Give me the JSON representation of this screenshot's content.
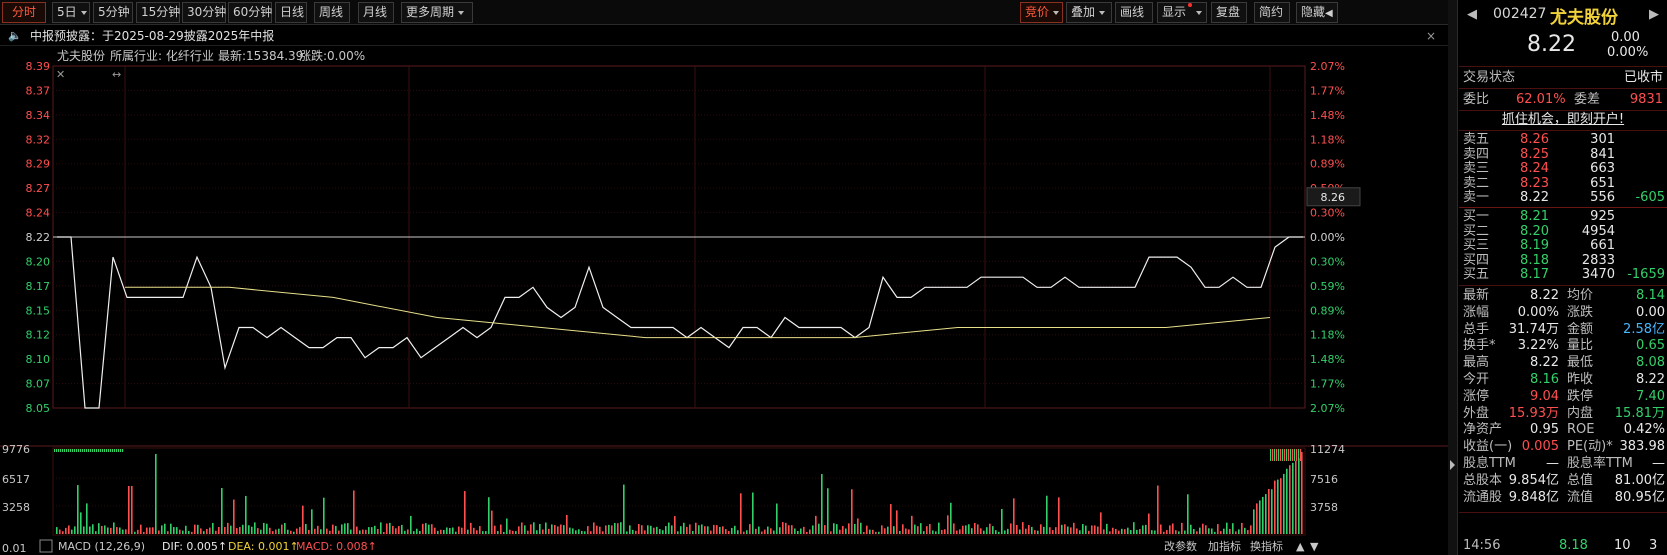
{
  "toolbar": {
    "left_buttons": [
      "分时",
      "5日",
      "5分钟",
      "15分钟",
      "30分钟",
      "60分钟",
      "日线",
      "周线",
      "月线",
      "更多周期"
    ],
    "right_buttons": [
      "竞价",
      "叠加",
      "画线",
      "显示",
      "复盘",
      "简约",
      "隐藏"
    ]
  },
  "notice": {
    "icon": "speaker-icon",
    "text": "中报预披露：于2025-08-29披露2025年中报",
    "close": "×"
  },
  "chart_header": {
    "stock": "尤夫股份",
    "industry_label": "所属行业: 化纤行业",
    "latest_label": "最新:15384.39",
    "change_label": "涨跌:0.00%"
  },
  "chart_data": {
    "type": "line",
    "price_axis": [
      "8.39",
      "8.37",
      "8.34",
      "8.32",
      "8.29",
      "8.27",
      "8.24",
      "8.22",
      "8.20",
      "8.17",
      "8.15",
      "8.12",
      "8.10",
      "8.07",
      "8.05"
    ],
    "pct_axis": [
      "2.07%",
      "1.77%",
      "1.48%",
      "1.18%",
      "0.89%",
      "0.59%",
      "0.30%",
      "0.00%",
      "0.30%",
      "0.59%",
      "0.89%",
      "1.18%",
      "1.48%",
      "1.77%",
      "2.07%"
    ],
    "ylim": [
      8.05,
      8.39
    ],
    "prev_close": 8.22,
    "hover_price": "8.26",
    "price_series": [
      8.22,
      8.22,
      8.05,
      8.05,
      8.2,
      8.16,
      8.16,
      8.16,
      8.16,
      8.16,
      8.2,
      8.17,
      8.09,
      8.13,
      8.13,
      8.12,
      8.13,
      8.12,
      8.11,
      8.11,
      8.12,
      8.12,
      8.1,
      8.11,
      8.11,
      8.12,
      8.1,
      8.11,
      8.12,
      8.13,
      8.12,
      8.13,
      8.16,
      8.16,
      8.17,
      8.15,
      8.14,
      8.15,
      8.19,
      8.15,
      8.14,
      8.13,
      8.13,
      8.13,
      8.13,
      8.12,
      8.13,
      8.12,
      8.11,
      8.13,
      8.13,
      8.12,
      8.14,
      8.13,
      8.13,
      8.13,
      8.13,
      8.12,
      8.13,
      8.18,
      8.16,
      8.16,
      8.17,
      8.17,
      8.17,
      8.17,
      8.18,
      8.18,
      8.18,
      8.18,
      8.17,
      8.17,
      8.18,
      8.17,
      8.17,
      8.17,
      8.17,
      8.17,
      8.2,
      8.2,
      8.2,
      8.19,
      8.17,
      8.17,
      8.18,
      8.17,
      8.17,
      8.21,
      8.22,
      8.22
    ],
    "avg_series": [
      8.17,
      8.17,
      8.16,
      8.14,
      8.13,
      8.12,
      8.12,
      8.12,
      8.13,
      8.13,
      8.13,
      8.14
    ],
    "volume_axis": [
      "9776",
      "6517",
      "3258",
      "0.01"
    ],
    "volume_axis_right": [
      "11274",
      "7516",
      "3758"
    ],
    "macd": {
      "label": "MACD (12,26,9)",
      "dif": "DIF: 0.005",
      "dea": "DEA: 0.001",
      "macd": "MACD: 0.008"
    },
    "macd_links": [
      "改参数",
      "加指标",
      "换指标"
    ]
  },
  "panel": {
    "code": "002427",
    "name": "尤夫股份",
    "price": "8.22",
    "change": "0.00",
    "change_pct": "0.00%",
    "trade_status_label": "交易状态",
    "trade_status": "已收市",
    "weibi_label": "委比",
    "weibi": "62.01%",
    "weicha_label": "委差",
    "weicha": "9831",
    "promo": "抓住机会，即刻开户!",
    "sell": [
      {
        "label": "卖五",
        "price": "8.26",
        "vol": "301",
        "diff": ""
      },
      {
        "label": "卖四",
        "price": "8.25",
        "vol": "841",
        "diff": ""
      },
      {
        "label": "卖三",
        "price": "8.24",
        "vol": "663",
        "diff": ""
      },
      {
        "label": "卖二",
        "price": "8.23",
        "vol": "651",
        "diff": ""
      },
      {
        "label": "卖一",
        "price": "8.22",
        "vol": "556",
        "diff": "-605"
      }
    ],
    "buy": [
      {
        "label": "买一",
        "price": "8.21",
        "vol": "925",
        "diff": ""
      },
      {
        "label": "买二",
        "price": "8.20",
        "vol": "4954",
        "diff": ""
      },
      {
        "label": "买三",
        "price": "8.19",
        "vol": "661",
        "diff": ""
      },
      {
        "label": "买四",
        "price": "8.18",
        "vol": "2833",
        "diff": ""
      },
      {
        "label": "买五",
        "price": "8.17",
        "vol": "3470",
        "diff": "-1659"
      }
    ],
    "stats": [
      {
        "l1": "最新",
        "v1": "8.22",
        "l2": "均价",
        "v2": "8.14"
      },
      {
        "l1": "涨幅",
        "v1": "0.00%",
        "l2": "涨跌",
        "v2": "0.00"
      },
      {
        "l1": "总手",
        "v1": "31.74万",
        "l2": "金额",
        "v2": "2.58亿"
      },
      {
        "l1": "换手*",
        "v1": "3.22%",
        "l2": "量比",
        "v2": "0.65"
      },
      {
        "l1": "最高",
        "v1": "8.22",
        "l2": "最低",
        "v2": "8.08"
      },
      {
        "l1": "今开",
        "v1": "8.16",
        "l2": "昨收",
        "v2": "8.22"
      },
      {
        "l1": "涨停",
        "v1": "9.04",
        "l2": "跌停",
        "v2": "7.40"
      },
      {
        "l1": "外盘",
        "v1": "15.93万",
        "l2": "内盘",
        "v2": "15.81万"
      },
      {
        "l1": "净资产",
        "v1": "0.95",
        "l2": "ROE",
        "v2": "0.42%"
      },
      {
        "l1": "收益(一)",
        "v1": "0.005",
        "l2": "PE(动)*",
        "v2": "383.98"
      },
      {
        "l1": "股息TTM",
        "v1": "—",
        "l2": "股息率TTM",
        "v2": "—"
      },
      {
        "l1": "总股本",
        "v1": "9.854亿",
        "l2": "总值",
        "v2": "81.00亿"
      },
      {
        "l1": "流通股",
        "v1": "9.848亿",
        "l2": "流值",
        "v2": "80.95亿"
      }
    ],
    "last_tick": {
      "time": "14:56",
      "price": "8.18",
      "vol": "10",
      "flag": "3"
    }
  },
  "colors": {
    "up": "#ff4f4f",
    "down": "#33d06a",
    "avg_line": "#e8e08a",
    "accent": "#ff5a3c"
  }
}
